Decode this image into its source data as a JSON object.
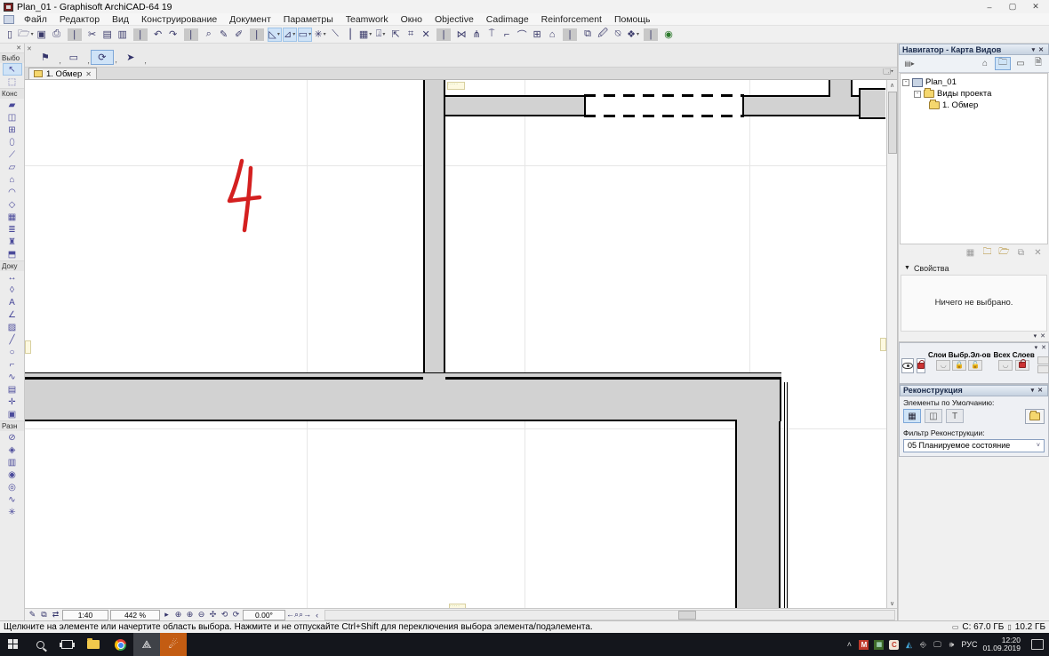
{
  "window": {
    "title": "Plan_01 - Graphisoft ArchiCAD-64 19",
    "minimize": "–",
    "maximize": "▢",
    "close": "✕"
  },
  "menu": {
    "items": [
      "Файл",
      "Редактор",
      "Вид",
      "Конструирование",
      "Документ",
      "Параметры",
      "Teamwork",
      "Окно",
      "Objective",
      "Cadimage",
      "Reinforcement",
      "Помощь"
    ]
  },
  "toolbar": {
    "icons": [
      {
        "g": "▯",
        "name": "new-icon"
      },
      {
        "g": "🗁",
        "name": "open-icon",
        "cls": "dd"
      },
      {
        "g": "▣",
        "name": "save-icon"
      },
      {
        "g": "⎙",
        "name": "print-icon"
      },
      {
        "g": "|",
        "name": "sep",
        "cls": "tbsep"
      },
      {
        "g": "✂",
        "name": "cut-icon"
      },
      {
        "g": "▤",
        "name": "copy-icon"
      },
      {
        "g": "▥",
        "name": "paste-icon"
      },
      {
        "g": "|",
        "name": "sep",
        "cls": "tbsep"
      },
      {
        "g": "↶",
        "name": "undo-icon"
      },
      {
        "g": "↷",
        "name": "redo-icon"
      },
      {
        "g": "|",
        "name": "sep",
        "cls": "tbsep"
      },
      {
        "g": "⌕",
        "name": "find-select-icon"
      },
      {
        "g": "✎",
        "name": "pick-parameters-icon"
      },
      {
        "g": "✐",
        "name": "inject-parameters-icon"
      },
      {
        "g": "|",
        "name": "sep",
        "cls": "tbsep"
      },
      {
        "g": "◺",
        "name": "gravity-icon",
        "cls": "dd blue"
      },
      {
        "g": "⊿",
        "name": "plane-snap-icon",
        "cls": "dd blue"
      },
      {
        "g": "▭",
        "name": "element-snap-icon",
        "cls": "dd blue"
      },
      {
        "g": "✳",
        "name": "snap-points-icon",
        "cls": "dd"
      },
      {
        "g": "⟍",
        "name": "slope-icon"
      },
      {
        "g": "⎮",
        "name": "guide-lines-icon"
      },
      {
        "g": "▦",
        "name": "grid-snap-icon",
        "cls": "dd"
      },
      {
        "g": "⍗",
        "name": "coordinates-icon",
        "cls": "dd"
      },
      {
        "g": "⇱",
        "name": "gravity-to-icon"
      },
      {
        "g": "⌗",
        "name": "grid-settings-icon"
      },
      {
        "g": "✕",
        "name": "close-group-icon"
      },
      {
        "g": "|",
        "name": "sep",
        "cls": "tbsep"
      },
      {
        "g": "⋈",
        "name": "trim-icon"
      },
      {
        "g": "⋔",
        "name": "split-icon"
      },
      {
        "g": "⍑",
        "name": "adjust-icon"
      },
      {
        "g": "⌐",
        "name": "fillet-icon"
      },
      {
        "g": "⌒",
        "name": "intersect-icon"
      },
      {
        "g": "⊞",
        "name": "resize-icon"
      },
      {
        "g": "⌂",
        "name": "solid-op-icon"
      },
      {
        "g": "|",
        "name": "sep",
        "cls": "tbsep"
      },
      {
        "g": "⧉",
        "name": "3d-view-icon"
      },
      {
        "g": "🖉",
        "name": "markup-icon"
      },
      {
        "g": "⍉",
        "name": "profile-icon"
      },
      {
        "g": "❖",
        "name": "library-icon",
        "cls": "dd"
      },
      {
        "g": "|",
        "name": "sep",
        "cls": "tbsep"
      },
      {
        "g": "◉",
        "name": "objective-icon",
        "cls": "grn"
      }
    ]
  },
  "minibar": {
    "buttons": [
      {
        "g": "⚑",
        "name": "favorites-button"
      },
      {
        "g": "▭",
        "name": "geometry-rect-button"
      },
      {
        "g": "⟳",
        "name": "rotated-geometry-button",
        "cls": "sel"
      },
      {
        "g": "➤",
        "name": "arrow-method-button"
      }
    ]
  },
  "palette": {
    "select_label": "Выбо",
    "construct_label": "Конс",
    "document_label": "Доку",
    "misc_label": "Разн",
    "select_tools": [
      {
        "g": "↖",
        "name": "arrow-tool-icon",
        "cls": "sel"
      },
      {
        "g": "⬚",
        "name": "marquee-tool-icon"
      }
    ],
    "construct_tools": [
      {
        "g": "▰",
        "name": "wall-tool-icon"
      },
      {
        "g": "◫",
        "name": "door-tool-icon"
      },
      {
        "g": "⊞",
        "name": "window-tool-icon"
      },
      {
        "g": "⬯",
        "name": "column-tool-icon"
      },
      {
        "g": "⟋",
        "name": "beam-tool-icon"
      },
      {
        "g": "▱",
        "name": "slab-tool-icon"
      },
      {
        "g": "⌂",
        "name": "roof-tool-icon"
      },
      {
        "g": "◠",
        "name": "shell-tool-icon"
      },
      {
        "g": "◇",
        "name": "morph-tool-icon"
      },
      {
        "g": "▦",
        "name": "mesh-tool-icon"
      },
      {
        "g": "≣",
        "name": "stair-tool-icon"
      },
      {
        "g": "♜",
        "name": "object-tool-icon"
      },
      {
        "g": "⬒",
        "name": "zone-tool-icon"
      }
    ],
    "document_tools": [
      {
        "g": "↔",
        "name": "dimension-tool-icon"
      },
      {
        "g": "◊",
        "name": "level-dimension-tool-icon"
      },
      {
        "g": "A",
        "name": "text-tool-icon"
      },
      {
        "g": "∠",
        "name": "label-tool-icon"
      },
      {
        "g": "▨",
        "name": "fill-tool-icon"
      },
      {
        "g": "╱",
        "name": "line-tool-icon"
      },
      {
        "g": "○",
        "name": "circle-tool-icon"
      },
      {
        "g": "⌐",
        "name": "polyline-tool-icon"
      },
      {
        "g": "∿",
        "name": "spline-tool-icon"
      },
      {
        "g": "▤",
        "name": "drawing-tool-icon"
      },
      {
        "g": "✛",
        "name": "hotspot-tool-icon"
      },
      {
        "g": "▣",
        "name": "figure-tool-icon"
      }
    ],
    "misc_tools": [
      {
        "g": "⊘",
        "name": "section-tool-icon"
      },
      {
        "g": "◈",
        "name": "elevation-tool-icon"
      },
      {
        "g": "▥",
        "name": "worksheet-tool-icon"
      },
      {
        "g": "◉",
        "name": "detail-tool-icon"
      },
      {
        "g": "◎",
        "name": "camera-tool-icon"
      },
      {
        "g": "∿",
        "name": "change-tool-icon"
      },
      {
        "g": "✳",
        "name": "axis-tool-icon"
      }
    ]
  },
  "tabbar": {
    "tab_label": "1. Обмер",
    "close": "✕",
    "tablist": "▾"
  },
  "canvas": {
    "annotation": "4"
  },
  "quickbar": {
    "left_icons": [
      {
        "g": "✎",
        "name": "pen-set-icon"
      },
      {
        "g": "⧉",
        "name": "quick-layers-icon"
      },
      {
        "g": "⇄",
        "name": "quick-options-icon"
      }
    ],
    "scale": "1:40",
    "zoom": "442 %",
    "play": "▸",
    "zoom_icons": [
      {
        "g": "⊕",
        "name": "zoom-default-icon"
      },
      {
        "g": "⊕",
        "name": "zoom-in-icon"
      },
      {
        "g": "⊖",
        "name": "zoom-out-icon"
      },
      {
        "g": "✣",
        "name": "pan-icon"
      },
      {
        "g": "⟲",
        "name": "fit-in-window-icon"
      },
      {
        "g": "⟳",
        "name": "rotate-view-icon"
      }
    ],
    "angle": "0.00°",
    "nav_icons": [
      {
        "g": "←⌕",
        "name": "previous-zoom-icon"
      },
      {
        "g": "⌕→",
        "name": "next-zoom-icon"
      },
      {
        "g": "‹",
        "name": "scroll-left-icon"
      }
    ]
  },
  "navigator": {
    "title": "Навигатор - Карта Видов",
    "collapse": "▾",
    "close": "✕",
    "chooser": "▤▸",
    "toolbar_icons": [
      {
        "g": "⌂",
        "name": "project-map-icon"
      },
      {
        "g": "🗀",
        "name": "view-map-icon",
        "cls": "sel"
      },
      {
        "g": "▭",
        "name": "layout-book-icon"
      },
      {
        "g": "🗎",
        "name": "publisher-icon"
      }
    ],
    "tree": [
      {
        "label": "Plan_01"
      },
      {
        "label": "Виды проекта"
      },
      {
        "label": "1. Обмер"
      }
    ],
    "action_icons": [
      {
        "g": "▦",
        "name": "view-settings-icon"
      },
      {
        "g": "🗀",
        "name": "new-folder-icon",
        "cls": "c"
      },
      {
        "g": "🗁",
        "name": "save-view-icon",
        "cls": "c"
      },
      {
        "g": "⧉",
        "name": "open-view-icon"
      },
      {
        "g": "✕",
        "name": "delete-view-icon"
      }
    ]
  },
  "properties": {
    "collapse": "▼",
    "title": "Свойства",
    "empty_text": "Ничего не выбрано.",
    "footer_collapse": "▾",
    "footer_close": "✕"
  },
  "layers": {
    "collapse": "▾",
    "close": "✕",
    "group1_label": "Слои Выбр.Эл-ов",
    "group2_label": "Всех Слоев"
  },
  "reconstruction": {
    "title": "Реконструкция",
    "collapse": "▾",
    "close": "✕",
    "default_label": "Элементы по Умолчанию:",
    "icons": [
      {
        "g": "▦",
        "name": "existing-elements-icon",
        "cls": "sel"
      },
      {
        "g": "◫",
        "name": "demolished-elements-icon"
      },
      {
        "g": "T",
        "name": "new-elements-icon"
      }
    ],
    "filter_label": "Фильтр Реконструкции:",
    "filter_value": "05 Планируемое состояние",
    "filter_caret": "˅"
  },
  "statusbar": {
    "message": "Щелкните на элементе или начертите область выбора. Нажмите и не отпускайте Ctrl+Shift для переключения выбора элемента/подэлемента.",
    "disk": "C: 67.0 ГБ",
    "memory": "10.2 ГБ"
  },
  "taskbar": {
    "tray_icons": [
      {
        "g": "˄",
        "name": "tray-chevron-icon"
      },
      {
        "g": "M",
        "name": "tray-app-m-icon",
        "cls": "red"
      },
      {
        "g": "▦",
        "name": "tray-app-green-icon",
        "cls": "grn2"
      },
      {
        "g": "C",
        "name": "tray-app-c-icon",
        "cls": "crc"
      },
      {
        "g": "◭",
        "name": "tray-app-teal-icon",
        "cls": "teal"
      },
      {
        "g": "⎆",
        "name": "usb-icon"
      },
      {
        "g": "🖵",
        "name": "network-icon"
      },
      {
        "g": "🕪",
        "name": "speaker-icon"
      }
    ],
    "language": "РУС",
    "time": "12:20",
    "date": "01.09.2019"
  },
  "colors": {
    "wall_fill": "#d2d2d2",
    "annotation_red": "#d42020",
    "selection_blue": "#cfe3f7",
    "taskbar_bg": "#14161c",
    "active_app_orange": "#c35c12",
    "panel_header": "#c6d2e0"
  }
}
